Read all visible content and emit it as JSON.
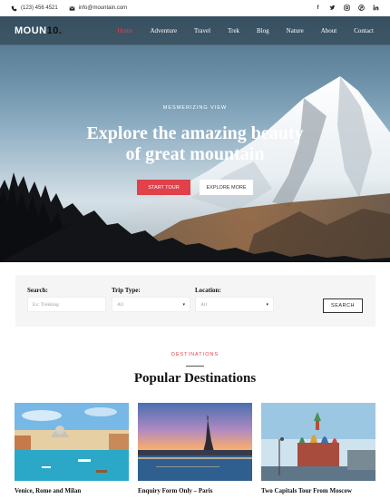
{
  "topbar": {
    "phone": "(123) 456 4521",
    "email": "info@mountain.com",
    "social": [
      "f",
      "t",
      "ig",
      "p",
      "in"
    ]
  },
  "nav": {
    "logo_main": "MOUN",
    "logo_num": "10.",
    "items": [
      "Home",
      "Adventure",
      "Travel",
      "Trek",
      "Blog",
      "Nature",
      "About",
      "Contact"
    ],
    "active": "Home"
  },
  "hero": {
    "eyebrow": "MESMERIZING VIEW",
    "title_line1": "Explore the amazing beauty",
    "title_line2": "of great mountain",
    "primary_button": "START TOUR",
    "secondary_button": "EXPLORE MORE"
  },
  "search": {
    "search_label": "Search:",
    "search_placeholder": "Ex: Trekking",
    "trip_label": "Trip Type:",
    "trip_value": "All",
    "location_label": "Location:",
    "location_value": "All",
    "button": "SEARCH"
  },
  "destinations": {
    "eyebrow": "DESTINATIONS",
    "title": "Popular Destinations",
    "cards": [
      {
        "title": "Venice, Rome and Milan"
      },
      {
        "title": "Enquiry Form Only – Paris"
      },
      {
        "title": "Two Capitals Tour From Moscow"
      }
    ]
  },
  "colors": {
    "accent": "#e0414a"
  }
}
